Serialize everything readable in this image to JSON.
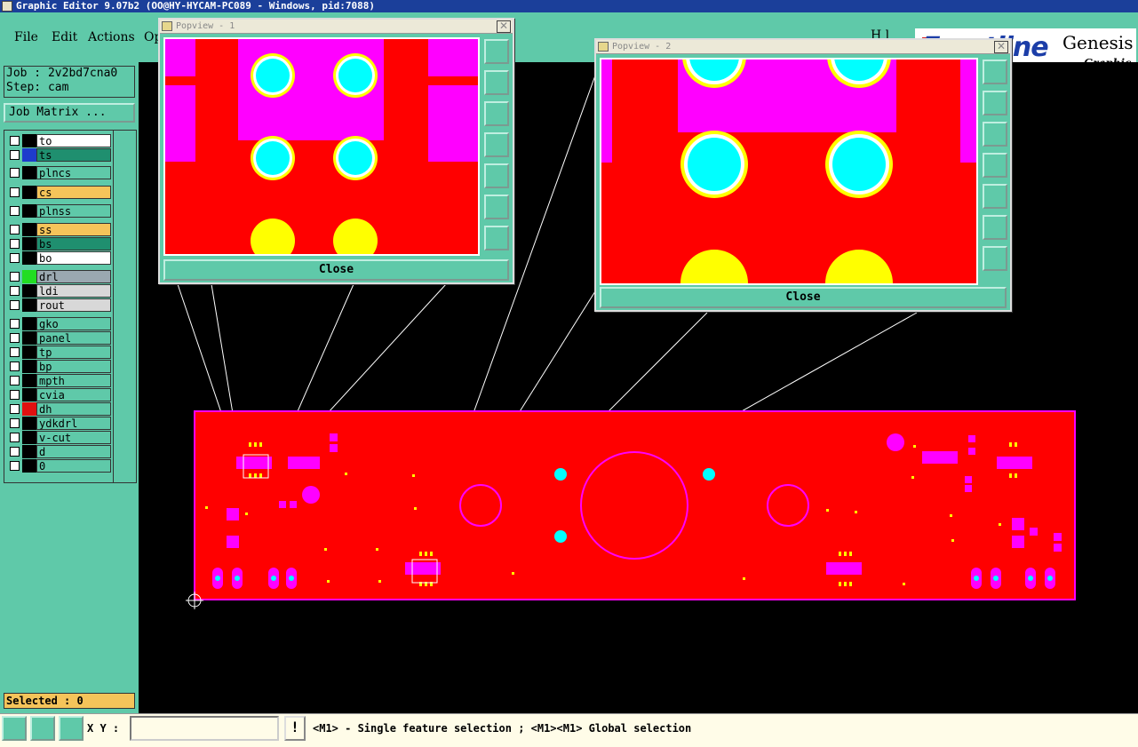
{
  "window": {
    "title": "Graphic Editor 9.07b2 (OO@HY-HYCAM-PC089 - Windows, pid:7088)"
  },
  "menu": {
    "file": "File",
    "edit": "Edit",
    "actions": "Actions",
    "options_partial": "Op",
    "help_partial": "H l"
  },
  "logo": {
    "brand": "Frontline",
    "product": "Genesis",
    "subtitle": "Graphic E"
  },
  "job": {
    "job_label": "Job : 2v2bd7cna0",
    "step_label": "Step: cam",
    "matrix_button": "Job Matrix ..."
  },
  "layers": [
    {
      "name": "to",
      "color": "#ffffff",
      "swatch": "#000000"
    },
    {
      "name": "ts",
      "color": "#1f8f6f",
      "swatch": "#1e3ccc"
    },
    {
      "name": "plncs",
      "color": "#5fc9a9",
      "swatch": "#000000"
    },
    {
      "name": "cs",
      "color": "#f5c45a",
      "swatch": "#000000"
    },
    {
      "name": "plnss",
      "color": "#5fc9a9",
      "swatch": "#000000"
    },
    {
      "name": "ss",
      "color": "#f5c45a",
      "swatch": "#000000"
    },
    {
      "name": "bs",
      "color": "#1f8f6f",
      "swatch": "#000000"
    },
    {
      "name": "bo",
      "color": "#ffffff",
      "swatch": "#000000"
    },
    {
      "name": "drl",
      "color": "#9aa8b0",
      "swatch": "#22dd22"
    },
    {
      "name": "ldi",
      "color": "#d8d8d8",
      "swatch": "#000000"
    },
    {
      "name": "rout",
      "color": "#d8d8d8",
      "swatch": "#000000"
    },
    {
      "name": "gko",
      "color": "#5fc9a9",
      "swatch": "#000000"
    },
    {
      "name": "panel",
      "color": "#5fc9a9",
      "swatch": "#000000"
    },
    {
      "name": "tp",
      "color": "#5fc9a9",
      "swatch": "#000000"
    },
    {
      "name": "bp",
      "color": "#5fc9a9",
      "swatch": "#000000"
    },
    {
      "name": "mpth",
      "color": "#5fc9a9",
      "swatch": "#000000"
    },
    {
      "name": "cvia",
      "color": "#5fc9a9",
      "swatch": "#000000"
    },
    {
      "name": "dh",
      "color": "#5fc9a9",
      "swatch": "#e01010"
    },
    {
      "name": "ydkdrl",
      "color": "#5fc9a9",
      "swatch": "#000000"
    },
    {
      "name": "v-cut",
      "color": "#5fc9a9",
      "swatch": "#000000"
    },
    {
      "name": "d",
      "color": "#5fc9a9",
      "swatch": "#000000"
    },
    {
      "name": "0",
      "color": "#5fc9a9",
      "swatch": "#000000"
    }
  ],
  "status": {
    "selected": "Selected : 0",
    "xy_label": "X Y :",
    "xy_value": "",
    "message": "<M1> - Single feature selection ; <M1><M1> Global selection",
    "warn_glyph": "!"
  },
  "popups": [
    {
      "title": "Popview - 1",
      "close_label": "Close",
      "x_glyph": "✕"
    },
    {
      "title": "Popview - 2",
      "close_label": "Close",
      "x_glyph": "✕"
    }
  ],
  "colors": {
    "ui_teal": "#5fc9a9",
    "board_red": "#ff0000",
    "pad_magenta": "#ff00ff",
    "drill_cyan": "#00ffff",
    "pad_yellow": "#ffff00",
    "canvas_black": "#000000"
  }
}
